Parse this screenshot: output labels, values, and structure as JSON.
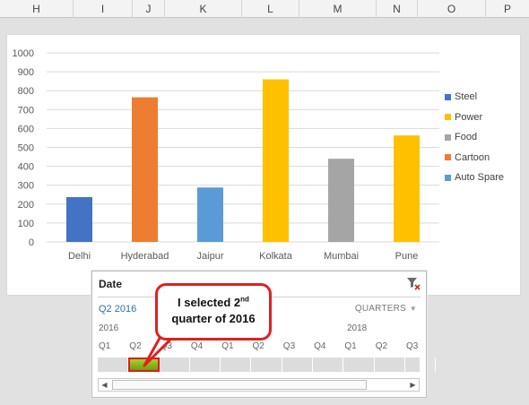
{
  "columns": [
    "H",
    "I",
    "J",
    "K",
    "L",
    "M",
    "N",
    "O",
    "P"
  ],
  "chart_data": {
    "type": "bar",
    "categories": [
      "Delhi",
      "Hyderabad",
      "Jaipur",
      "Kolkata",
      "Mumbai",
      "Pune"
    ],
    "values": [
      237,
      765,
      288,
      860,
      440,
      563
    ],
    "bar_colors": [
      "#4472c4",
      "#ed7d31",
      "#5b9bd5",
      "#ffc000",
      "#a5a5a5",
      "#ffc000"
    ],
    "ylim": [
      0,
      1000
    ],
    "yticks": [
      "0",
      "100",
      "200",
      "300",
      "400",
      "500",
      "600",
      "700",
      "800",
      "900",
      "1000"
    ],
    "grid": true,
    "legend_placement": "right",
    "legend": [
      {
        "name": "Steel",
        "color": "#4472c4"
      },
      {
        "name": "Power",
        "color": "#ffc000"
      },
      {
        "name": "Food",
        "color": "#a5a5a5"
      },
      {
        "name": "Cartoon",
        "color": "#ed7d31"
      },
      {
        "name": "Auto Spare",
        "color": "#5b9bd5"
      }
    ]
  },
  "slicer": {
    "title": "Date",
    "selection": "Q2 2016",
    "time_level": "QUARTERS",
    "years": [
      "2016",
      "2018"
    ],
    "quarters": [
      "Q1",
      "Q2",
      "Q3",
      "Q4",
      "Q1",
      "Q2",
      "Q3",
      "Q4",
      "Q1",
      "Q2",
      "Q3"
    ],
    "selected_quarter_index": 1
  },
  "callout": {
    "line1_prefix": "I selected 2",
    "line1_sup": "nd",
    "line2": "quarter of 2016"
  }
}
